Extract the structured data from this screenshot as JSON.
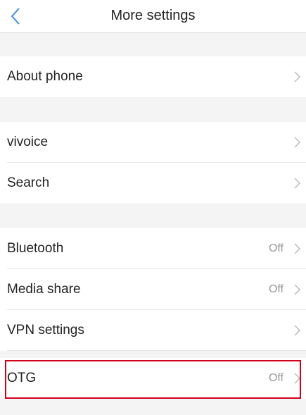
{
  "header": {
    "title": "More settings",
    "back_icon": "chevron-left-icon",
    "accent_color": "#3d8fe0"
  },
  "items": [
    {
      "label": "About phone",
      "value": ""
    },
    {
      "label": "vivoice",
      "value": ""
    },
    {
      "label": "Search",
      "value": ""
    },
    {
      "label": "Bluetooth",
      "value": "Off"
    },
    {
      "label": "Media share",
      "value": "Off"
    },
    {
      "label": "VPN settings",
      "value": ""
    },
    {
      "label": "OTG",
      "value": "Off"
    }
  ],
  "highlight": {
    "item": "OTG",
    "color": "#d0021b"
  }
}
